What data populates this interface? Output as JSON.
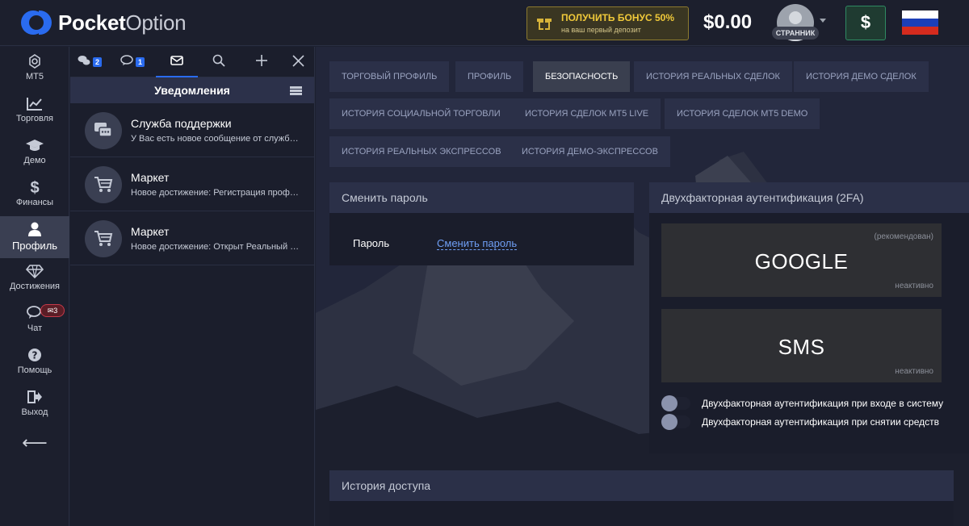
{
  "header": {
    "logo_bold": "Pocket",
    "logo_light": "Option",
    "bonus_title": "ПОЛУЧИТЬ БОНУС 50%",
    "bonus_sub": "на ваш первый депозит",
    "balance": "$0.00",
    "user_badge": "СТРАННИК",
    "deposit_symbol": "$",
    "colors": {
      "accent": "#2a6bef",
      "bonus": "#f0c93a",
      "deposit": "#2e8a62"
    }
  },
  "sidebar": {
    "items": [
      {
        "label": "MT5",
        "icon": "mt5-icon"
      },
      {
        "label": "Торговля",
        "icon": "chart-icon"
      },
      {
        "label": "Демо",
        "icon": "graduation-cap-icon"
      },
      {
        "label": "Финансы",
        "icon": "dollar-icon"
      },
      {
        "label": "Профиль",
        "icon": "user-icon"
      },
      {
        "label": "Достижения",
        "icon": "diamond-icon"
      },
      {
        "label": "Чат",
        "icon": "chat-icon",
        "badge": "3"
      },
      {
        "label": "Помощь",
        "icon": "help-icon"
      },
      {
        "label": "Выход",
        "icon": "logout-icon"
      }
    ]
  },
  "panel": {
    "tabs": [
      {
        "icon": "comments-icon",
        "count": "2"
      },
      {
        "icon": "chat-bubble-icon",
        "count": "1"
      },
      {
        "icon": "envelope-icon"
      },
      {
        "icon": "search-icon"
      },
      {
        "icon": "plus-icon"
      },
      {
        "icon": "close-icon"
      }
    ],
    "title": "Уведомления",
    "notifications": [
      {
        "title": "Служба поддержки",
        "text": "У Вас есть новое сообщение от службы поддержки",
        "icon": "support-chat-icon"
      },
      {
        "title": "Маркет",
        "text": "Новое достижение: Регистрация профиля",
        "icon": "cart-icon"
      },
      {
        "title": "Маркет",
        "text": "Новое достижение: Открыт Реальный счет",
        "icon": "cart-icon"
      }
    ]
  },
  "main": {
    "tabs": [
      "Торговый профиль",
      "Профиль",
      "Безопасность",
      "История реальных сделок",
      "История демо сделок",
      "История социальной торговли",
      "История сделок MT5 Live",
      "История сделок MT5 Demo",
      "История реальных экспрессов",
      "История демо-экспрессов"
    ],
    "active_tab": "Безопасность",
    "password_card": {
      "title": "Сменить пароль",
      "label": "Пароль",
      "link": "Сменить пароль"
    },
    "tfa_card": {
      "title": "Двухфакторная аутентификация (2FA)",
      "google": {
        "name": "GOOGLE",
        "recommended": "(рекомендован)",
        "state": "неактивно"
      },
      "sms": {
        "name": "SMS",
        "state": "неактивно"
      },
      "toggles": [
        {
          "label": "Двухфакторная аутентификация при входе в систему",
          "on": false
        },
        {
          "label": "Двухфакторная аутентификация при снятии средств",
          "on": false
        }
      ]
    },
    "access_card": {
      "title": "История доступа"
    }
  }
}
